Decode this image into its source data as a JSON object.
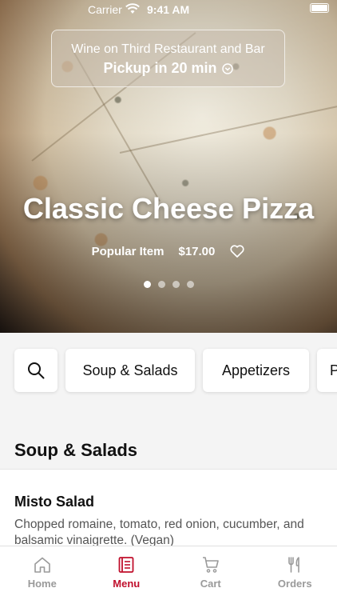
{
  "status_bar": {
    "carrier": "Carrier",
    "time": "9:41 AM"
  },
  "restaurant": {
    "name": "Wine on Third Restaurant and Bar",
    "pickup": "Pickup in 20 min"
  },
  "featured": {
    "title": "Classic Cheese Pizza",
    "tag": "Popular Item",
    "price": "$17.00",
    "page_count": 4,
    "active_index": 0
  },
  "categories": [
    {
      "label": "Soup & Salads"
    },
    {
      "label": "Appetizers"
    },
    {
      "label": "P"
    }
  ],
  "section": {
    "title": "Soup & Salads"
  },
  "menu_items": [
    {
      "name": "Misto Salad",
      "description": "Chopped romaine, tomato, red onion, cucumber, and balsamic vinaigrette. (Vegan)"
    }
  ],
  "tabs": [
    {
      "label": "Home",
      "icon": "home-icon",
      "active": false
    },
    {
      "label": "Menu",
      "icon": "menu-icon",
      "active": true
    },
    {
      "label": "Cart",
      "icon": "cart-icon",
      "active": false
    },
    {
      "label": "Orders",
      "icon": "utensils-icon",
      "active": false
    }
  ],
  "colors": {
    "accent": "#c0102d",
    "inactive": "#9a9a9a"
  }
}
